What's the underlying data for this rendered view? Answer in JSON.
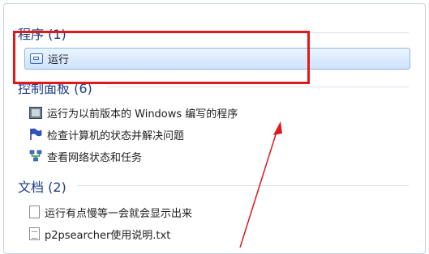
{
  "search_results": {
    "programs": {
      "heading": "程序 (1)",
      "items": [
        {
          "label": "运行",
          "icon": "run-dialog-icon"
        }
      ]
    },
    "control_panel": {
      "heading": "控制面板 (6)",
      "items": [
        {
          "label": "运行为以前版本的 Windows 编写的程序",
          "icon": "compatibility-icon"
        },
        {
          "label": "检查计算机的状态并解决问题",
          "icon": "action-center-flag-icon"
        },
        {
          "label": "查看网络状态和任务",
          "icon": "network-icon"
        }
      ]
    },
    "documents": {
      "heading": "文档 (2)",
      "items": [
        {
          "label": "运行有点慢等一会就会显示出来",
          "icon": "text-document-icon"
        },
        {
          "label": "p2psearcher使用说明.txt",
          "icon": "text-file-icon"
        }
      ]
    }
  },
  "annotation": {
    "color": "#e0181c"
  }
}
